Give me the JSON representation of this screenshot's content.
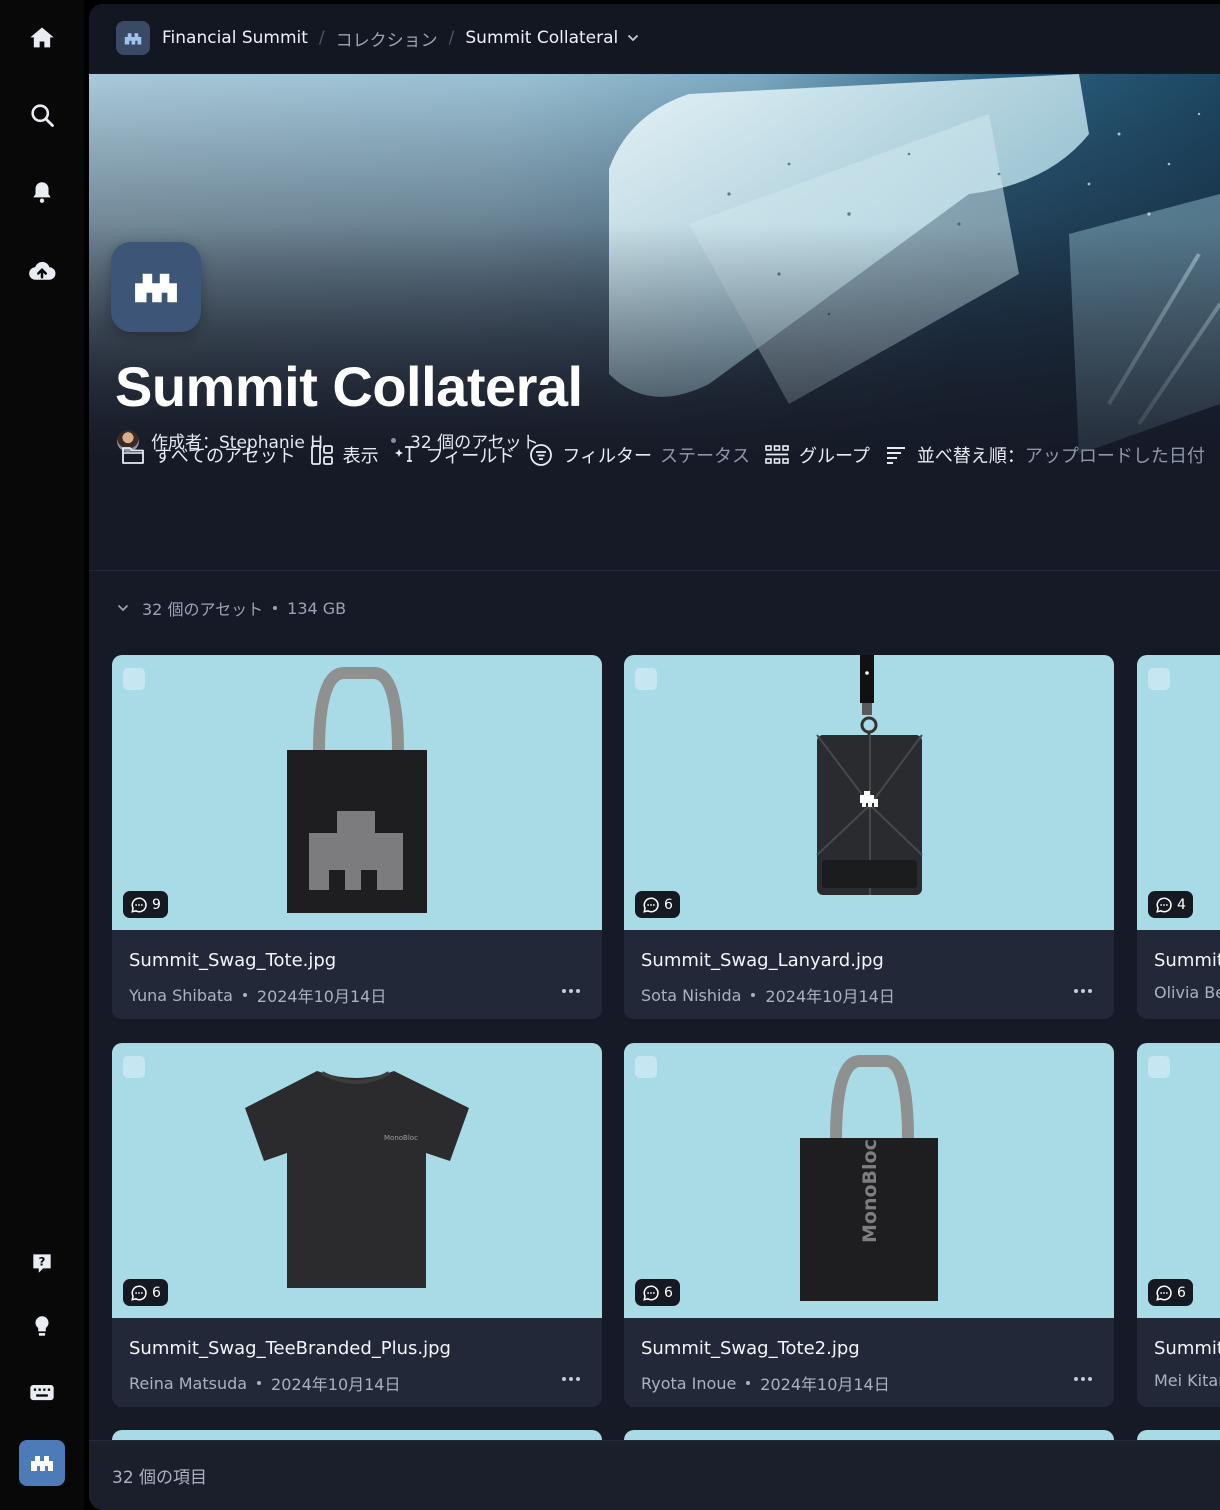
{
  "workspace": {
    "name": "Financial Summit"
  },
  "breadcrumb": {
    "collections": "コレクション",
    "current": "Summit Collateral"
  },
  "collection": {
    "title": "Summit Collateral",
    "creator": "作成者：Stephanie H",
    "asset_count": "32 個のアセット"
  },
  "toolbar": {
    "all_assets": "すべてのアセット",
    "view": "表示",
    "fields": "フィールド",
    "filter": "フィルター",
    "filter_value": "ステータス",
    "group": "グループ",
    "sort": "並べ替え順：",
    "sort_value": "アップロードした日付"
  },
  "summary": {
    "count": "32 個のアセット",
    "size": "134 GB"
  },
  "cards": [
    {
      "name": "Summit_Swag_Tote.jpg",
      "author": "Yuna Shibata",
      "date": "2024年10月14日",
      "comments": "9"
    },
    {
      "name": "Summit_Swag_Lanyard.jpg",
      "author": "Sota Nishida",
      "date": "2024年10月14日",
      "comments": "6"
    },
    {
      "name": "Summit",
      "author": "Olivia Ber",
      "date": "",
      "comments": "4"
    },
    {
      "name": "Summit_Swag_TeeBranded_Plus.jpg",
      "author": "Reina Matsuda",
      "date": "2024年10月14日",
      "comments": "6"
    },
    {
      "name": "Summit_Swag_Tote2.jpg",
      "author": "Ryota Inoue",
      "date": "2024年10月14日",
      "comments": "6"
    },
    {
      "name": "Summit",
      "author": "Mei Kitar",
      "date": "",
      "comments": "6"
    }
  ],
  "tshirt_brand": "MonoBloc",
  "tote2_brand": "MonoBloc",
  "footer": {
    "items": "32 個の項目"
  },
  "colors": {
    "accent": "#4d7bb8",
    "background": "#161a27",
    "thumb": "#a8dbe6"
  },
  "icons": [
    "home-icon",
    "search-icon",
    "bell-icon",
    "upload-cloud-icon",
    "help-icon",
    "lightbulb-icon",
    "keyboard-icon",
    "brand-logo-icon"
  ]
}
